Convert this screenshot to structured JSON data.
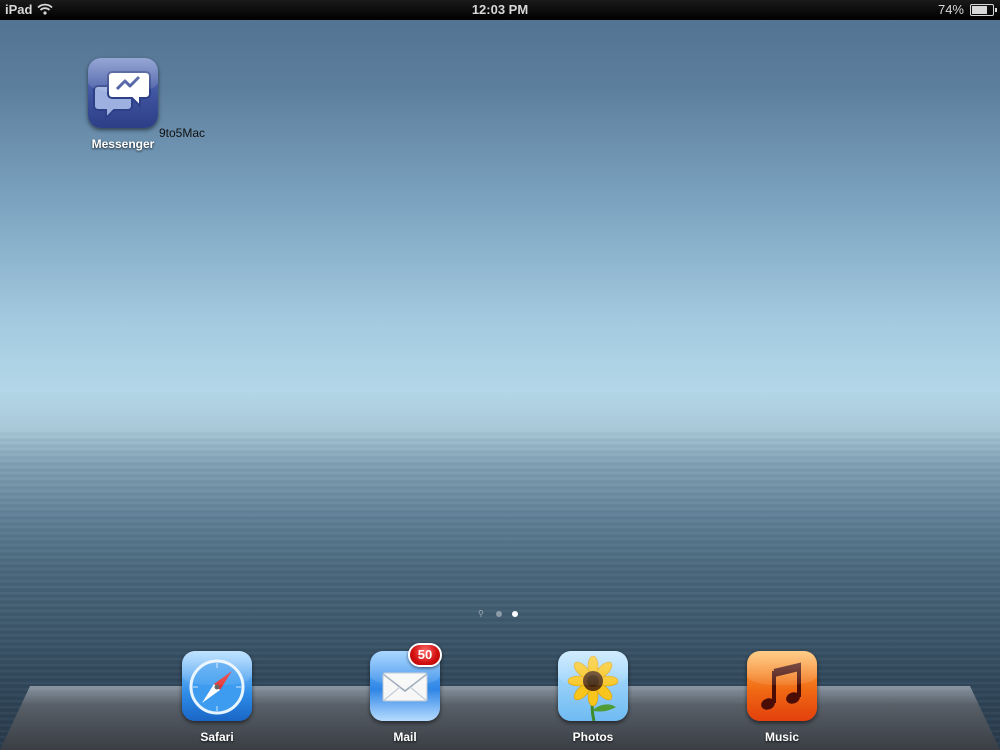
{
  "status_bar": {
    "carrier": "iPad",
    "wifi_icon": "wifi-icon",
    "time": "12:03 PM",
    "battery_percent": "74%",
    "battery_level": 0.74
  },
  "home_screen": {
    "apps": [
      {
        "label": "Messenger",
        "icon": "messenger-icon"
      }
    ],
    "watermark": "9to5Mac",
    "page_dots": {
      "count": 3,
      "active_index": 2,
      "first_is_search": true
    }
  },
  "dock": {
    "apps": [
      {
        "label": "Safari",
        "icon": "safari-compass-icon"
      },
      {
        "label": "Mail",
        "icon": "mail-envelope-icon",
        "badge": "50"
      },
      {
        "label": "Photos",
        "icon": "sunflower-icon"
      },
      {
        "label": "Music",
        "icon": "music-note-icon"
      }
    ]
  }
}
